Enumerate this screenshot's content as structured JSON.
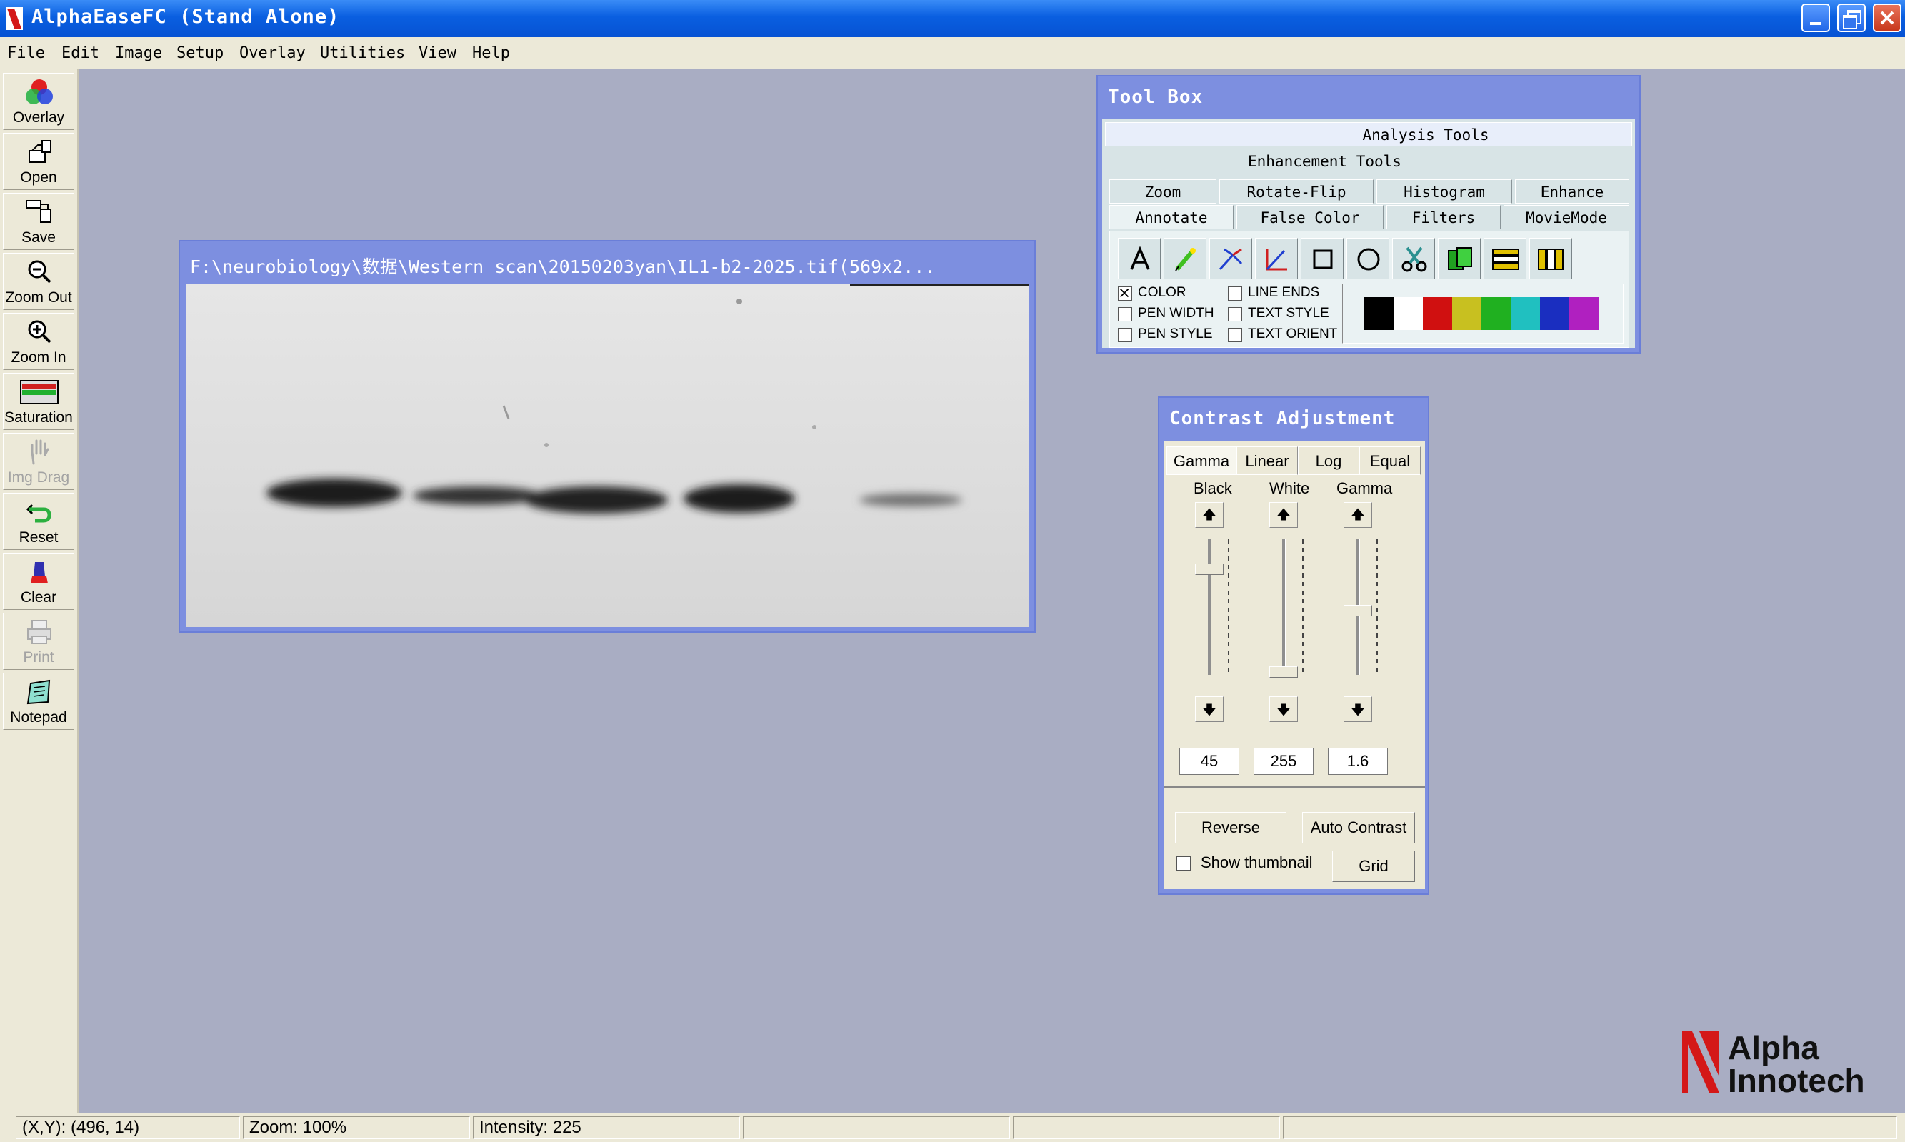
{
  "window": {
    "title": "AlphaEaseFC (Stand Alone)"
  },
  "menu": [
    "File",
    "Edit",
    "Image",
    "Setup",
    "Overlay",
    "Utilities",
    "View",
    "Help"
  ],
  "toolbar": [
    {
      "label": "Overlay",
      "icon": "overlay-icon",
      "enabled": true
    },
    {
      "label": "Open",
      "icon": "open-icon",
      "enabled": true
    },
    {
      "label": "Save",
      "icon": "save-icon",
      "enabled": true
    },
    {
      "label": "Zoom Out",
      "icon": "zoom-out-icon",
      "enabled": true
    },
    {
      "label": "Zoom In",
      "icon": "zoom-in-icon",
      "enabled": true
    },
    {
      "label": "Saturation",
      "icon": "saturation-icon",
      "enabled": true
    },
    {
      "label": "Img Drag",
      "icon": "hand-icon",
      "enabled": false
    },
    {
      "label": "Reset",
      "icon": "reset-icon",
      "enabled": true
    },
    {
      "label": "Clear",
      "icon": "clear-icon",
      "enabled": true
    },
    {
      "label": "Print",
      "icon": "print-icon",
      "enabled": false
    },
    {
      "label": "Notepad",
      "icon": "notepad-icon",
      "enabled": true
    }
  ],
  "image_window": {
    "title": "F:\\neurobiology\\数据\\Western scan\\20150203yan\\IL1-b2-2025.tif(569x2..."
  },
  "toolbox": {
    "title": "Tool Box",
    "analysis_label": "Analysis Tools",
    "enhancement_label": "Enhancement Tools",
    "tabs_row1": [
      "Zoom",
      "Rotate-Flip",
      "Histogram",
      "Enhance"
    ],
    "tabs_row2": [
      "Annotate",
      "False Color",
      "Filters",
      "MovieMode"
    ],
    "active_tab": "Annotate",
    "tools": [
      "text-icon",
      "pen-icon",
      "arrow-icon",
      "line-icon",
      "rectangle-icon",
      "ellipse-icon",
      "scissors-icon",
      "copy-icon",
      "layers-icon",
      "columns-icon"
    ],
    "checkboxes_left": [
      {
        "label": "COLOR",
        "checked": true
      },
      {
        "label": "PEN WIDTH",
        "checked": false
      },
      {
        "label": "PEN STYLE",
        "checked": false
      }
    ],
    "checkboxes_right": [
      {
        "label": "LINE ENDS",
        "checked": false
      },
      {
        "label": "TEXT STYLE",
        "checked": false
      },
      {
        "label": "TEXT ORIENT",
        "checked": false
      }
    ],
    "colors": [
      "#000000",
      "#ffffff",
      "#d01010",
      "#c8c020",
      "#20b020",
      "#20c0c0",
      "#1a2ec0",
      "#b020c0"
    ]
  },
  "contrast": {
    "title": "Contrast Adjustment",
    "tabs": [
      "Gamma",
      "Linear",
      "Log",
      "Equal"
    ],
    "active_tab": "Gamma",
    "columns": [
      {
        "label": "Black",
        "value": "45"
      },
      {
        "label": "White",
        "value": "255"
      },
      {
        "label": "Gamma",
        "value": "1.6"
      }
    ],
    "reverse_label": "Reverse",
    "auto_label": "Auto Contrast",
    "thumbnail_label": "Show thumbnail",
    "grid_label": "Grid"
  },
  "logo": {
    "line1": "Alpha",
    "line2": "Innotech"
  },
  "status": {
    "xy": "(X,Y): (496, 14)",
    "zoom": "Zoom: 100%",
    "intensity": "Intensity: 225"
  }
}
